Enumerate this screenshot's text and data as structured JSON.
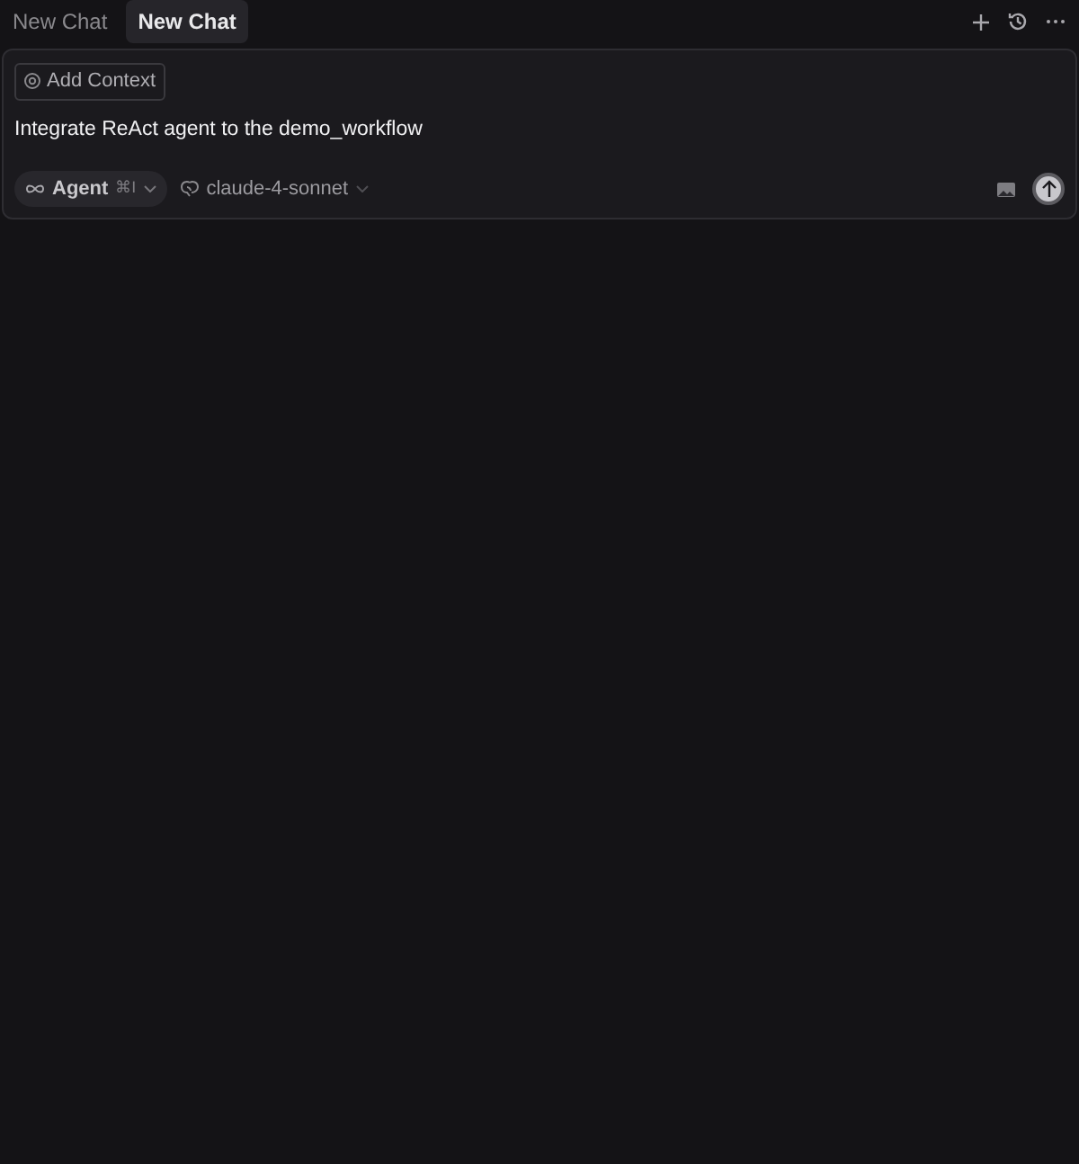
{
  "tabs": [
    {
      "label": "New Chat",
      "selected": false
    },
    {
      "label": "New Chat",
      "selected": true
    }
  ],
  "composer": {
    "context_button": "Add Context",
    "value": "Integrate ReAct agent to the demo_workflow",
    "mode": {
      "label": "Agent",
      "shortcut": "⌘I"
    },
    "model": "claude-4-sonnet"
  }
}
